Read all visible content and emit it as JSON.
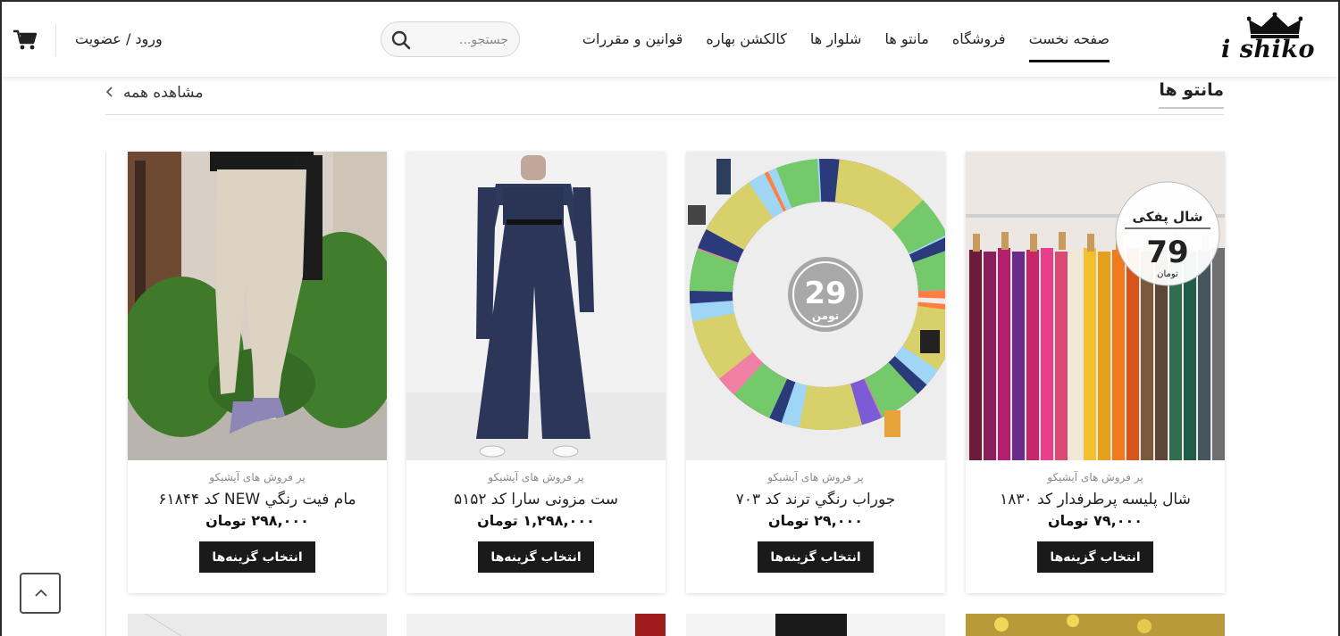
{
  "header": {
    "logo_text": "i shiko",
    "nav": [
      {
        "label": "صفحه نخست",
        "active": true
      },
      {
        "label": "فروشگاه"
      },
      {
        "label": "مانتو ها"
      },
      {
        "label": "شلوار ها"
      },
      {
        "label": "کالکشن بهاره"
      },
      {
        "label": "قوانین و مقررات"
      }
    ],
    "search_placeholder": "جستجو...",
    "login_label": "ورود / عضویت"
  },
  "section": {
    "title": "مانتو ها",
    "view_all": "مشاهده همه"
  },
  "products": [
    {
      "category": "پر فروش های آیشیکو",
      "name": "شال پلیسه پرطرفدار کد ۱۸۳۰",
      "price": "۷۹,۰۰۰ تومان",
      "button": "انتخاب گزینه‌ها",
      "badge_caption": "شال پفکی",
      "badge_number": "79",
      "badge_unit": "تومان"
    },
    {
      "category": "پر فروش های آیشیکو",
      "name": "جوراب رنگي ترند کد ۷۰۳",
      "price": "۲۹,۰۰۰ تومان",
      "button": "انتخاب گزینه‌ها",
      "badge_number": "29",
      "badge_unit": "تومن"
    },
    {
      "category": "پر فروش های آیشیکو",
      "name": "ست مزونی سارا کد ۵۱۵۲",
      "price": "۱,۲۹۸,۰۰۰ تومان",
      "button": "انتخاب گزینه‌ها"
    },
    {
      "category": "پر فروش های آیشیکو",
      "name": "مام فیت رنگي NEW کد ۶۱۸۴۴",
      "price": "۲۹۸,۰۰۰ تومان",
      "button": "انتخاب گزینه‌ها"
    }
  ],
  "colors": {
    "accent": "#1a1a1a",
    "price": "#111111",
    "muted": "#8a8a8a"
  },
  "icons": {
    "cart": "cart-icon",
    "search": "search-icon",
    "back_to_top": "chevron-up-icon",
    "view_all": "chevron-left-icon",
    "logo": "crown-icon"
  }
}
